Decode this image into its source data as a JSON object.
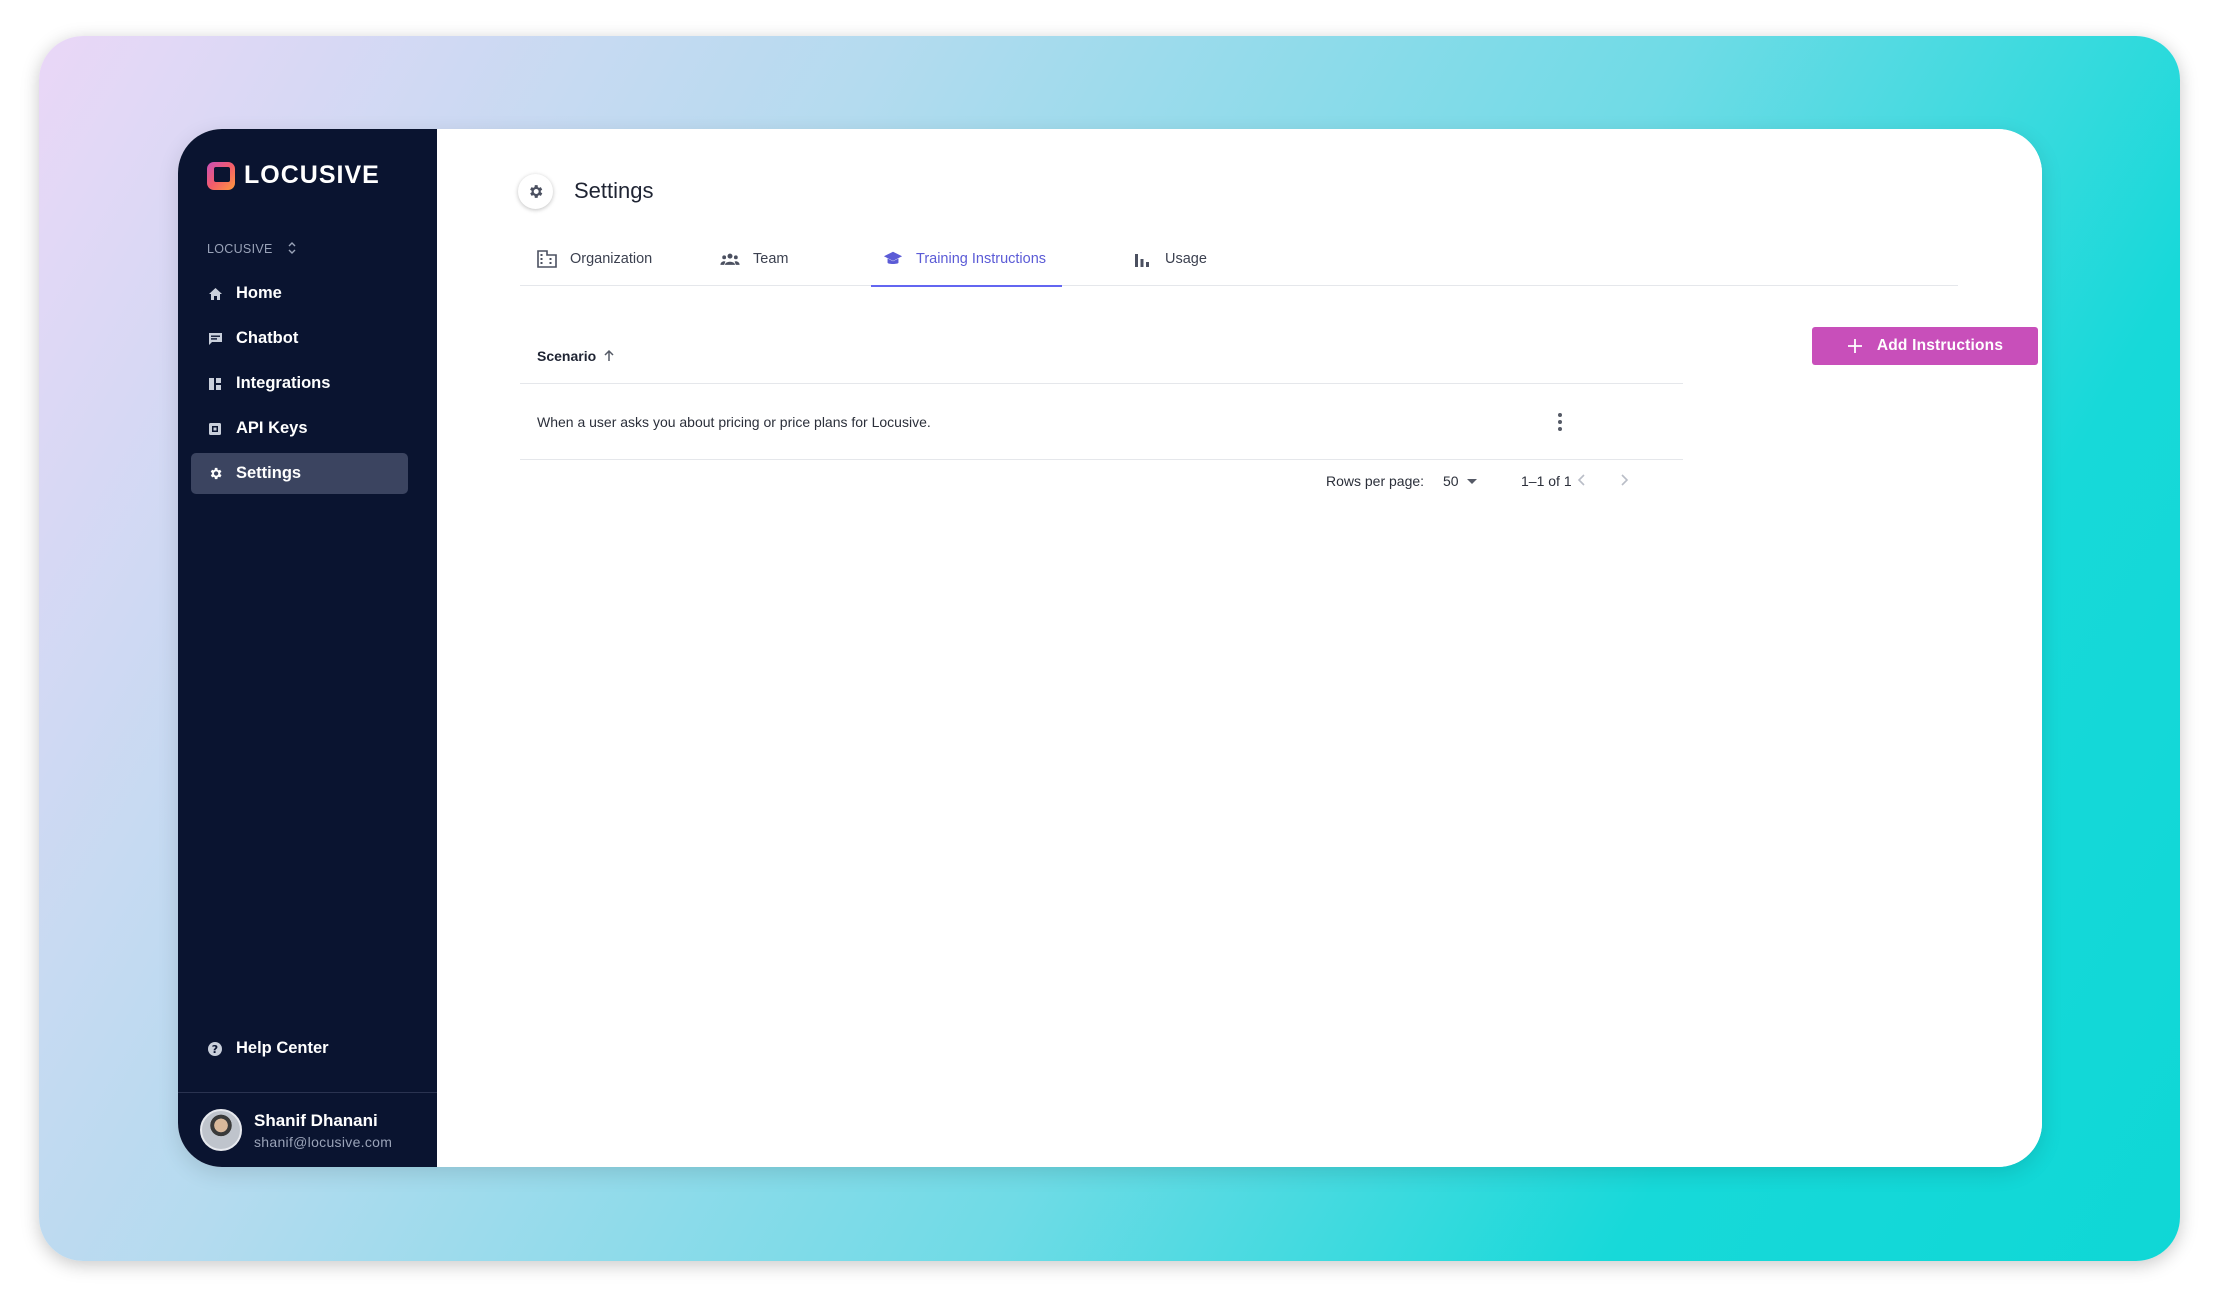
{
  "brand": {
    "name": "LOCUSIVE"
  },
  "sidebar": {
    "workspace": "LOCUSIVE",
    "items": [
      {
        "label": "Home",
        "icon": "home-icon"
      },
      {
        "label": "Chatbot",
        "icon": "chat-icon"
      },
      {
        "label": "Integrations",
        "icon": "dashboard-icon"
      },
      {
        "label": "API Keys",
        "icon": "api-key-icon"
      },
      {
        "label": "Settings",
        "icon": "gear-icon",
        "active": true
      }
    ],
    "help": "Help Center",
    "user": {
      "name": "Shanif Dhanani",
      "email": "shanif@locusive.com"
    }
  },
  "header": {
    "title": "Settings"
  },
  "tabs": [
    {
      "label": "Organization",
      "icon": "building-icon"
    },
    {
      "label": "Team",
      "icon": "group-icon"
    },
    {
      "label": "Training Instructions",
      "icon": "graduation-cap-icon",
      "active": true
    },
    {
      "label": "Usage",
      "icon": "bar-chart-icon"
    }
  ],
  "table": {
    "column": "Scenario",
    "rows": [
      {
        "scenario": "When a user asks you about pricing or price plans for Locusive."
      }
    ]
  },
  "pagination": {
    "rows_per_page_label": "Rows per page:",
    "rows_per_page": "50",
    "range": "1–1 of 1"
  },
  "actions": {
    "add_label": "Add Instructions"
  },
  "colors": {
    "sidebar_bg": "#0a1430",
    "accent": "#5b5bd6",
    "button": "#c84fba"
  }
}
